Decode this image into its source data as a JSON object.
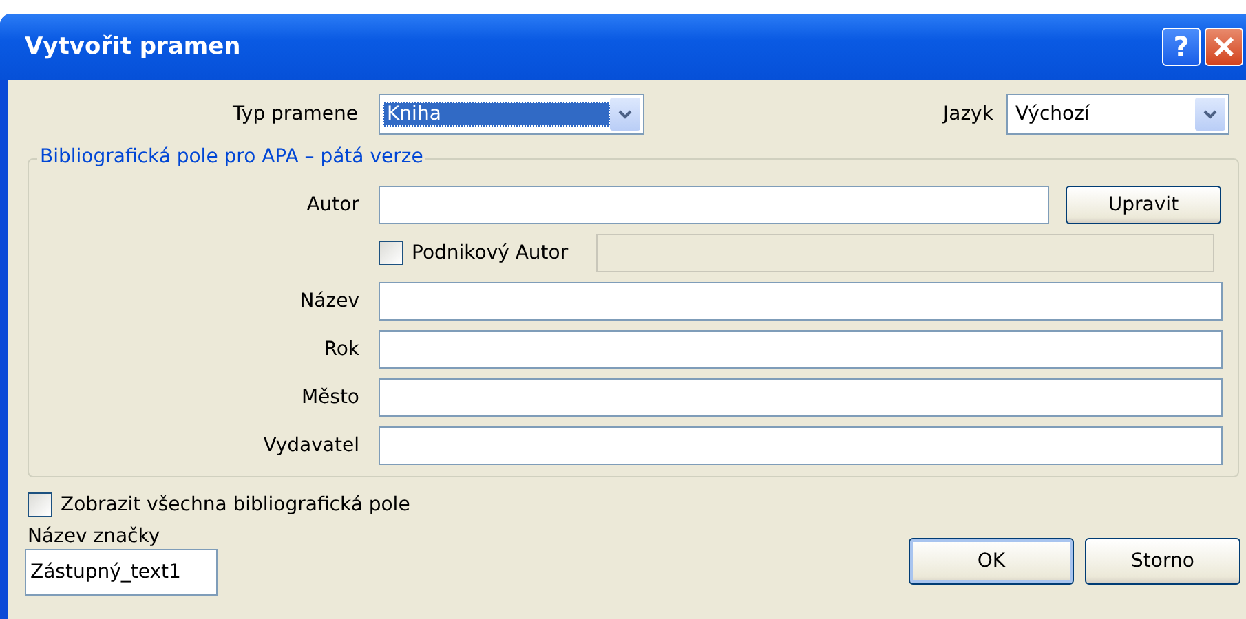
{
  "window": {
    "title": "Vytvořit pramen",
    "help_button": "?"
  },
  "source_type": {
    "label": "Typ pramene",
    "value": "Kniha",
    "focused": true
  },
  "language": {
    "label": "Jazyk",
    "value": "Výchozí",
    "focused": false
  },
  "group": {
    "legend": "Bibliografická pole pro APA – pátá verze",
    "rows": [
      {
        "kind": "text",
        "label": "Autor",
        "button": "Upravit"
      },
      {
        "kind": "checkbox",
        "label": "Podnikový Autor",
        "checked": false
      },
      {
        "kind": "text",
        "label": "Název"
      },
      {
        "kind": "text",
        "label": "Rok"
      },
      {
        "kind": "text",
        "label": "Město"
      },
      {
        "kind": "text",
        "label": "Vydavatel"
      }
    ]
  },
  "show_all": {
    "label": "Zobrazit všechna bibliografická pole",
    "checked": false
  },
  "tag_name": {
    "label": "Název značky",
    "value": "Zástupný_text1"
  },
  "buttons": [
    {
      "label": "OK",
      "default": true
    },
    {
      "label": "Storno",
      "default": false
    }
  ]
}
